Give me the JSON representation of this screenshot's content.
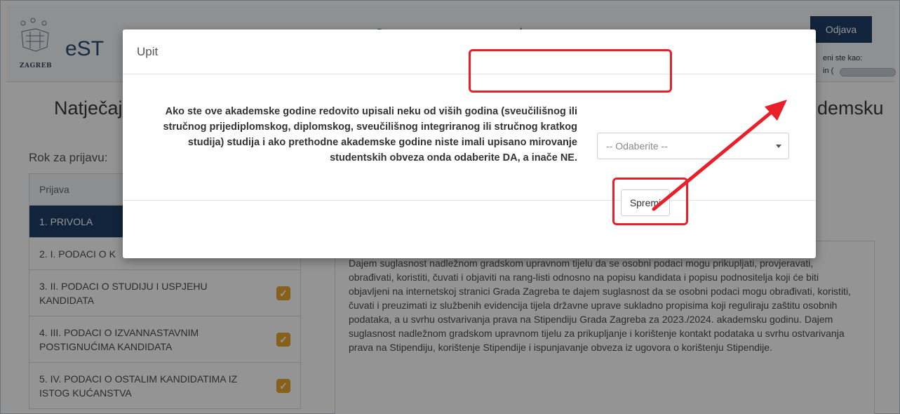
{
  "header": {
    "logo_caption": "ZAGREB",
    "app_name": "eST",
    "logout_label": "Odjava",
    "logged_in_as": "eni ste kao:",
    "user_prefix": "in ("
  },
  "page": {
    "title": "Natječaj",
    "title_right": "demsku",
    "deadline_label": "Rok za prijavu:"
  },
  "sidebar": {
    "items": [
      {
        "label": "Prijava",
        "state": "header"
      },
      {
        "label": "1. PRIVOLA",
        "state": "active"
      },
      {
        "label": "2. I. PODACI O K",
        "state": "normal"
      },
      {
        "label": "3. II. PODACI O STUDIJU I USPJEHU KANDIDATA",
        "state": "checked"
      },
      {
        "label": "4. III. PODACI O IZVANNASTAVNIM POSTIGNUĆIMA KANDIDATA",
        "state": "checked"
      },
      {
        "label": "5. IV. PODACI O OSTALIM KANDIDATIMA IZ ISTOG KUĆANSTVA",
        "state": "checked"
      }
    ]
  },
  "consent_text": "Dajem suglasnost nadležnom gradskom upravnom tijelu da se osobni podaci mogu prikupljati, provjeravati, obrađivati, koristiti, čuvati i objaviti na rang-listi odnosno na popisu kandidata i popisu podnositelja koji će biti objavljeni na internetskoj stranici Grada Zagreba te dajem suglasnost da se osobni podaci mogu obrađivati, koristiti, čuvati i preuzimati iz službenih evidencija tijela državne uprave sukladno propisima koji reguliraju zaštitu osobnih podataka, a u svrhu ostvarivanja prava na Stipendiju Grada Zagreba za 2023./2024. akademsku godinu. Dajem suglasnost nadležnom gradskom upravnom tijelu za prikupljanje i korištenje kontakt podataka u svrhu ostvarivanja prava na Stipendiju, korištenje Stipendije i ispunjavanje obveza iz ugovora o korištenju Stipendije.",
  "modal": {
    "title": "Upit",
    "question": "Ako ste ove akademske godine redovito upisali neku od viših godina (sveučilišnog ili stručnog prijediplomskog, diplomskog, sveučilišnog integriranog ili stručnog kratkog studija) studija i ako prethodne akademske godine niste imali upisano mirovanje studentskih obveza onda odaberite DA, a inače NE.",
    "select_value": "-- Odaberite --",
    "save_label": "Spremi"
  },
  "colors": {
    "primary": "#1f3e66",
    "check": "#e8a531",
    "annotation": "#e8202a"
  }
}
